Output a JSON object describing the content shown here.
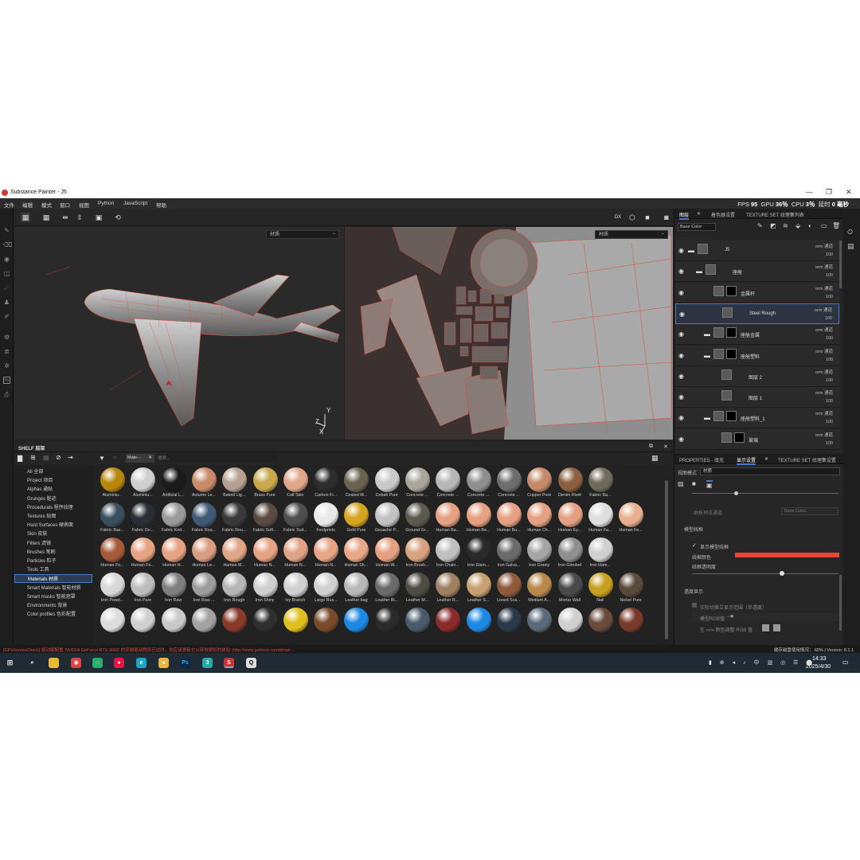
{
  "title_bar": {
    "app_title": "Substance Painter - J5"
  },
  "menu": [
    "文件",
    "编辑",
    "模式",
    "窗口",
    "视图",
    "Python",
    "JavaScript",
    "帮助"
  ],
  "stats": {
    "fps_label": "FPS",
    "fps": "95",
    "gpu_label": "GPU",
    "gpu": "36％",
    "cpu_label": "CPU",
    "cpu": "3％",
    "latency_label": "延时",
    "latency": "0 毫秒"
  },
  "viewport": {
    "left_select": "材质",
    "right_select": "材质",
    "axis_x": "X",
    "axis_y": "Y",
    "axis_z": "Z",
    "toolbar_mode": "DX"
  },
  "shelf": {
    "title": "SHELF 层架",
    "search_tag": "Mate···",
    "search_placeholder": "搜索...",
    "categories": [
      "All 全部",
      "Project 项目",
      "Alphas 通贴",
      "Grunges 脏迹",
      "Procedurals 程序纹理",
      "Textures 贴图",
      "Hard Surfaces 硬表面",
      "Skin 皮肤",
      "Filters 滤镜",
      "Brushes 笔刷",
      "Particles 粒子",
      "Tools 工具",
      "Materials 材质",
      "Smart Materials 智能材质",
      "Smart masks 智能遮罩",
      "Environments 背景",
      "Color profiles 色彩配置"
    ],
    "selected_category": "Materials 材质",
    "materials": [
      [
        "Aluminiu...",
        "Aluminiu...",
        "Artificial L...",
        "Autumn Le...",
        "Baked Lig...",
        "Brass Pure",
        "Calf Skin",
        "Carbon Fi...",
        "Coated M...",
        "Cobalt Pure",
        "Concrete ...",
        "Concrete ...",
        "Concrete ...",
        "Concrete ...",
        "Copper Pure",
        "Denim Rivet",
        "Fabric Ba..."
      ],
      [
        "Fabric Bas...",
        "Fabric De...",
        "Fabric Knit...",
        "Fabric Rou...",
        "Fabric Rou...",
        "Fabric Soft...",
        "Fabric Suit...",
        "Footprints",
        "Gold Pure",
        "Gouache P...",
        "Ground Gr...",
        "Human Ba...",
        "Human Be...",
        "Human Bu...",
        "Human Ch...",
        "Human Ey...",
        "Human Fa...",
        "Human Fe..."
      ],
      [
        "Human Fo...",
        "Human Fo...",
        "Human H...",
        "Human Le...",
        "Human M...",
        "Human N...",
        "Human N...",
        "Human N...",
        "Human Sh...",
        "Human W...",
        "Iron Brush...",
        "Iron Chain...",
        "Iron Diam...",
        "Iron Galva...",
        "Iron Grainy",
        "Iron Grinded",
        "Iron Ham..."
      ],
      [
        "Iron Powd...",
        "Iron Pure",
        "Iron Raw",
        "Iron Raw ...",
        "Iron Rough",
        "Iron Shiny",
        "Ivy Branch",
        "Large Rus...",
        "Leather bag",
        "Leather Bi...",
        "Leather M...",
        "Leather R...",
        "Leather S...",
        "Lizard Sca...",
        "Medium A...",
        "Mortar Wall",
        "Nail",
        "Nickel Pure"
      ],
      [
        "",
        "",
        "",
        "",
        "",
        "",
        "",
        "",
        "",
        "",
        "",
        "",
        "",
        "",
        "",
        "",
        "",
        ""
      ]
    ]
  },
  "status_bar": {
    "warning": "[GPUIssuesCheck] 驱动版配置 'NVIDIA GeForce RTX 3060' 的安装驱动程序已过时。你应该更新它以获得更好的体验 (http://www.geforce.com/driver···",
    "right": "缓存磁盘使用情况：  60%  |  Version: 8.1.1"
  },
  "taskbar": {
    "time": "14:33",
    "date": "2025/4/30"
  },
  "layers_panel": {
    "tabs": [
      "图层",
      "着色器设置",
      "TEXTURE SET 纹理集列表"
    ],
    "channel_select": "Base Color",
    "layers": [
      {
        "name": "J5",
        "blend": "orm 通道",
        "opacity": "100"
      },
      {
        "name": "座舱",
        "blend": "orm 通道",
        "opacity": "100"
      },
      {
        "name": "金属杆",
        "blend": "orm 通道",
        "opacity": "100"
      },
      {
        "name": "Steel Rough",
        "blend": "orm 通道",
        "opacity": "100"
      },
      {
        "name": "座舱金属",
        "blend": "orm 通道",
        "opacity": "100"
      },
      {
        "name": "座舱塑料",
        "blend": "orm 通道",
        "opacity": "100"
      },
      {
        "name": "图层 2",
        "blend": "orm 通道",
        "opacity": "100"
      },
      {
        "name": "图层 1",
        "blend": "orm 通道",
        "opacity": "100"
      },
      {
        "name": "座舱塑料_1",
        "blend": "orm 通道",
        "opacity": "100"
      },
      {
        "name": "玻璃",
        "blend": "orm 通道",
        "opacity": "100"
      }
    ]
  },
  "properties_panel": {
    "tabs": [
      "PROPERTIES - 填充",
      "显示设置",
      "TEXTURE SET 纹理集设置"
    ],
    "view_mode_label": "视图模式",
    "view_mode_value": "材质",
    "channel_label": "纳析预览通道",
    "channel_value": "Base Color",
    "wireframe_section": "模型线框",
    "show_wireframe": "显示模型线框",
    "wireframe_color": "线框颜色",
    "wireframe_opacity": "线框透明度",
    "transparent_section": "透度显示",
    "transparent_opt1": "实际切换立显示范围（半透度）",
    "transparent_opt2": "模型RGB值",
    "transparent_opt3": "在 ∞/∞ 颜色调整 RGB 值",
    "wire_color_hex": "#e8463a",
    "wire_opacity": 0.6
  }
}
